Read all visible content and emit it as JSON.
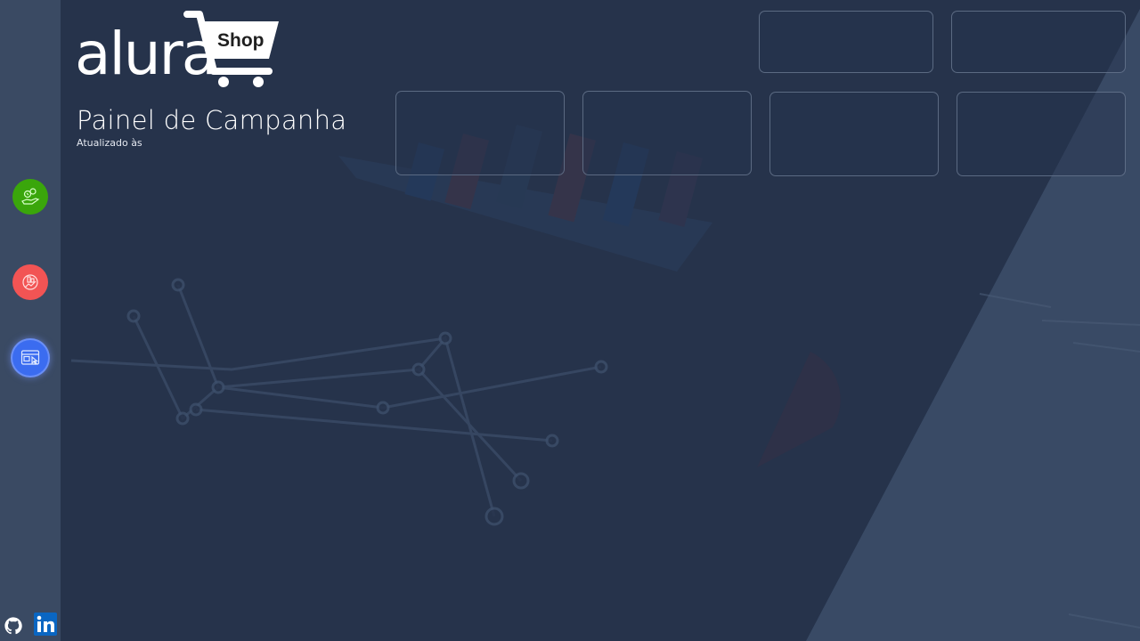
{
  "brand": {
    "logo_text": "alura",
    "cart_label": "Shop"
  },
  "header": {
    "title": "Painel de Campanha",
    "updated_label": "Atualizado às"
  },
  "sidebar": {
    "items": [
      {
        "name": "sales-nav",
        "icon": "money-hand-icon",
        "color": "#3aa60b"
      },
      {
        "name": "performance-nav",
        "icon": "target-chart-icon",
        "color": "#f25454"
      },
      {
        "name": "marketing-nav",
        "icon": "browser-cursor-icon",
        "color": "#3b6cf0",
        "active": true
      }
    ]
  },
  "footer_links": [
    {
      "name": "github",
      "icon": "github-icon"
    },
    {
      "name": "linkedin",
      "icon": "linkedin-icon",
      "color": "#0a66c2"
    }
  ],
  "cards": {
    "top_row_count": 2,
    "second_row_count": 4
  },
  "colors": {
    "background": "#2b3952",
    "sidebar": "#3a4a63",
    "card_border": "#6e7d96"
  }
}
